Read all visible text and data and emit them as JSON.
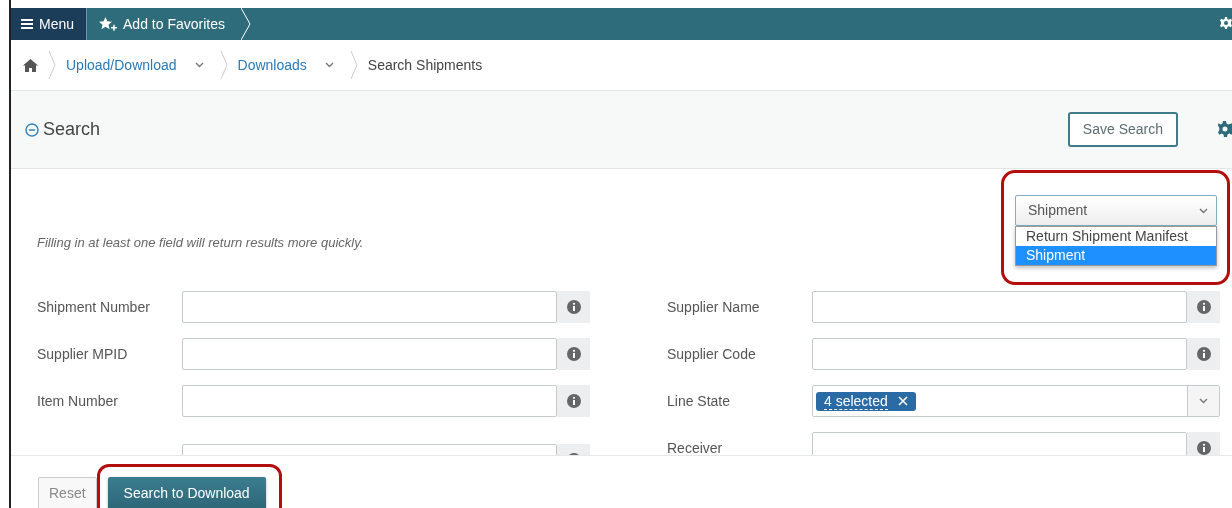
{
  "topbar": {
    "menu_label": "Menu",
    "favorites_label": "Add to Favorites"
  },
  "breadcrumb": [
    {
      "label": "Upload/Download",
      "kind": "menu-link"
    },
    {
      "label": "Downloads",
      "kind": "menu-link"
    },
    {
      "label": "Search Shipments",
      "kind": "current"
    }
  ],
  "search_panel": {
    "title": "Search",
    "expanded": true,
    "save_button": "Save Search"
  },
  "type_select": {
    "value": "Shipment",
    "expanded": true,
    "highlighted": true,
    "options": [
      {
        "label": "Return Shipment Manifest",
        "selected": false
      },
      {
        "label": "Shipment",
        "selected": true
      }
    ]
  },
  "hint": "Filling in at least one field will return results more quickly.",
  "left_fields": [
    {
      "label": "Shipment Number",
      "kind": "text"
    },
    {
      "label": "Supplier MPID",
      "kind": "text"
    },
    {
      "label": "Item Number",
      "kind": "text"
    },
    {
      "kind": "text"
    }
  ],
  "right_fields": [
    {
      "label": "Supplier Name",
      "kind": "text"
    },
    {
      "label": "Supplier Code",
      "kind": "text"
    },
    {
      "label": "Line State",
      "kind": "multiselect",
      "tag": "4 selected"
    },
    {
      "label": "Receiver",
      "kind": "text"
    }
  ],
  "buttons": [
    {
      "label": "Reset",
      "kind": "secondary",
      "highlighted": false
    },
    {
      "label": "Search to Download",
      "kind": "primary",
      "highlighted": true
    }
  ]
}
